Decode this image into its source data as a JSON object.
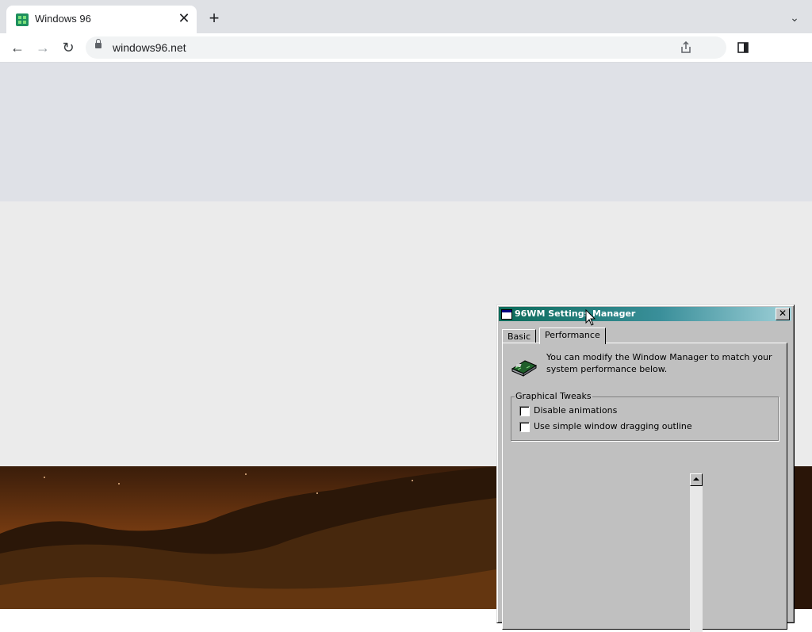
{
  "browser": {
    "tab": {
      "title": "Windows 96",
      "favicon": "windows96-logo-icon",
      "close_glyph": "✕"
    },
    "new_tab_glyph": "+",
    "tab_search_glyph": "⌄",
    "back_glyph": "←",
    "forward_glyph": "→",
    "reload_glyph": "↻",
    "url": "windows96.net"
  },
  "dialog": {
    "title": "96WM Settings Manager",
    "close_glyph": "✕",
    "tabs": [
      {
        "label": "Basic",
        "active": false
      },
      {
        "label": "Performance",
        "active": true
      }
    ],
    "intro": "You can modify the Window Manager to match your system performance below.",
    "group": {
      "label": "Graphical Tweaks",
      "options": [
        {
          "label": "Disable animations",
          "checked": false
        },
        {
          "label": "Use simple window dragging outline",
          "checked": false
        }
      ]
    }
  }
}
